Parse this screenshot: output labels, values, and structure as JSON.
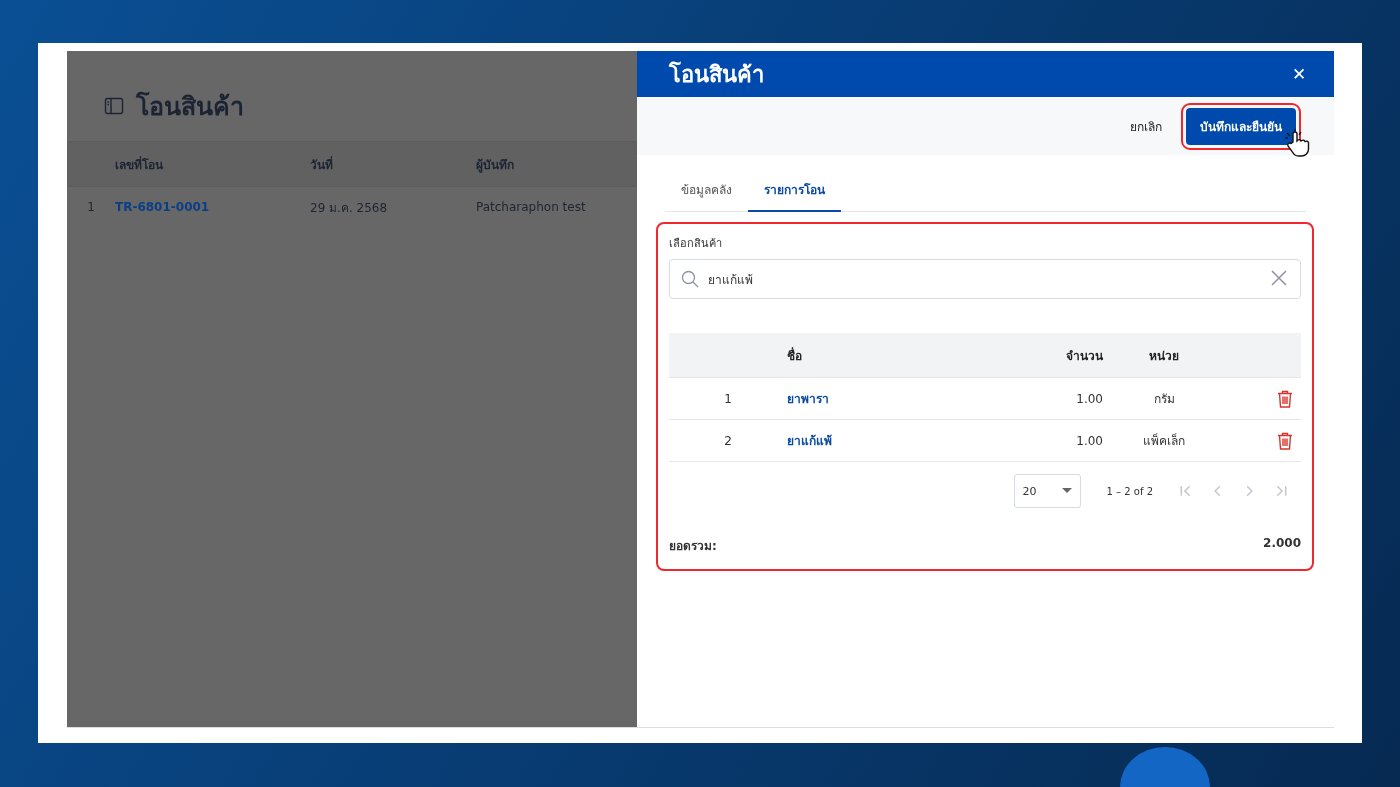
{
  "page": {
    "title": "โอนสินค้า",
    "table": {
      "columns": [
        "เลขที่โอน",
        "วันที่",
        "ผู้บันทึก"
      ],
      "rows": [
        {
          "index": "1",
          "number": "TR-6801-0001",
          "date": "29 ม.ค. 2568",
          "recorder": "Patcharaphon test"
        }
      ]
    }
  },
  "drawer": {
    "title": "โอนสินค้า",
    "close": "✕",
    "cancel": "ยกเลิก",
    "confirm": "บันทึกและยืนยัน",
    "tabs": [
      {
        "label": "ข้อมูลคลัง",
        "selected": false
      },
      {
        "label": "รายการโอน",
        "selected": true
      }
    ],
    "search": {
      "label": "เลือกสินค้า",
      "value": "ยาแก้แพ้"
    },
    "table": {
      "columns": [
        "ชื่อ",
        "จำนวน",
        "หน่วย"
      ],
      "rows": [
        {
          "index": "1",
          "name": "ยาพารา",
          "quantity": "1.00",
          "unit": "กรัม"
        },
        {
          "index": "2",
          "name": "ยาแก้แพ้",
          "quantity": "1.00",
          "unit": "แพ็คเล็ก"
        }
      ]
    },
    "paginator": {
      "page_size": "20",
      "range": "1 – 2 of 2",
      "buttons": [
        {
          "kind": "first",
          "disabled": true
        },
        {
          "kind": "prev",
          "disabled": true
        },
        {
          "kind": "next",
          "disabled": true
        },
        {
          "kind": "last",
          "disabled": true
        }
      ]
    },
    "total": {
      "label": "ยอดรวม:",
      "value": "2.000"
    }
  }
}
